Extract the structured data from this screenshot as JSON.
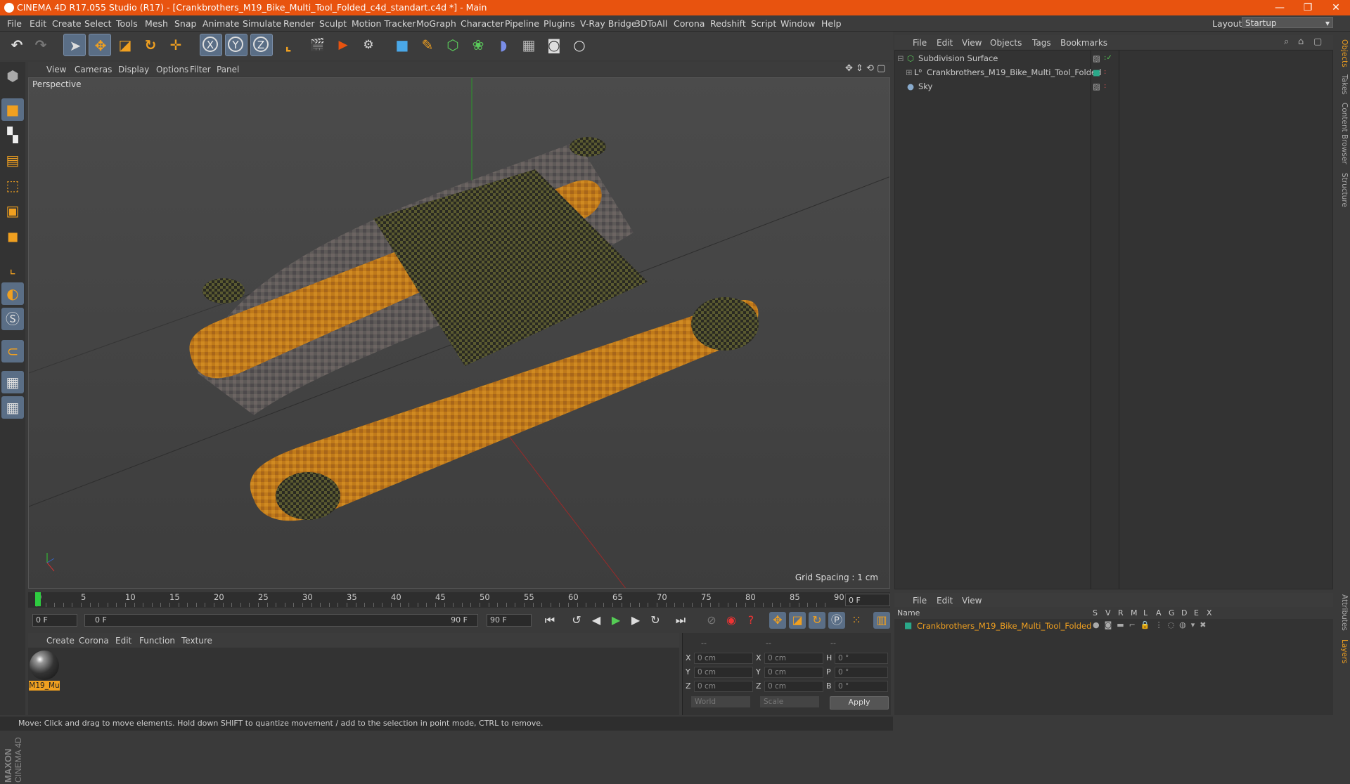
{
  "window": {
    "title": "CINEMA 4D R17.055 Studio (R17) - [Crankbrothers_M19_Bike_Multi_Tool_Folded_c4d_standart.c4d *] - Main",
    "minimize": "—",
    "restore": "❐",
    "close": "✕"
  },
  "menu": [
    "File",
    "Edit",
    "Create",
    "Select",
    "Tools",
    "Mesh",
    "Snap",
    "Animate",
    "Simulate",
    "Render",
    "Sculpt",
    "Motion Tracker",
    "MoGraph",
    "Character",
    "Pipeline",
    "Plugins",
    "V-Ray Bridge",
    "3DToAll",
    "Corona",
    "Redshift",
    "Script",
    "Window",
    "Help"
  ],
  "layout": {
    "label": "Layout:",
    "value": "Startup"
  },
  "viewport": {
    "menu": [
      "View",
      "Cameras",
      "Display",
      "Options",
      "Filter",
      "Panel"
    ],
    "label": "Perspective",
    "grid_spacing": "Grid Spacing : 1 cm"
  },
  "timeline": {
    "ticks": [
      "0",
      "5",
      "10",
      "15",
      "20",
      "25",
      "30",
      "35",
      "40",
      "45",
      "50",
      "55",
      "60",
      "65",
      "70",
      "75",
      "80",
      "85",
      "90"
    ],
    "current_frame": "0 F",
    "start": "0 F",
    "range_start": "0 F",
    "range_end": "90 F",
    "end": "90 F"
  },
  "materials": {
    "menu": [
      "Create",
      "Corona",
      "Edit",
      "Function",
      "Texture"
    ],
    "items": [
      {
        "name": "M19_Mu"
      }
    ]
  },
  "coordinates": {
    "headers": [
      "--",
      "--",
      "--"
    ],
    "rows": [
      {
        "l1": "X",
        "v1": "0 cm",
        "l2": "X",
        "v2": "0 cm",
        "l3": "H",
        "v3": "0 °"
      },
      {
        "l1": "Y",
        "v1": "0 cm",
        "l2": "Y",
        "v2": "0 cm",
        "l3": "P",
        "v3": "0 °"
      },
      {
        "l1": "Z",
        "v1": "0 cm",
        "l2": "Z",
        "v2": "0 cm",
        "l3": "B",
        "v3": "0 °"
      }
    ],
    "mode": "World",
    "scale": "Scale",
    "apply": "Apply"
  },
  "status": "Move: Click and drag to move elements. Hold down SHIFT to quantize movement / add to the selection in point mode, CTRL to remove.",
  "objects": {
    "menu": [
      "File",
      "Edit",
      "View",
      "Objects",
      "Tags",
      "Bookmarks"
    ],
    "rows": [
      {
        "name": "Subdivision Surface",
        "icon": "subdivision-icon"
      },
      {
        "name": "Crankbrothers_M19_Bike_Multi_Tool_Folded",
        "icon": "null-object-icon"
      },
      {
        "name": "Sky",
        "icon": "sky-icon"
      }
    ]
  },
  "layers": {
    "menu": [
      "File",
      "Edit",
      "View"
    ],
    "columns": [
      "Name",
      "S",
      "V",
      "R",
      "M",
      "L",
      "A",
      "G",
      "D",
      "E",
      "X"
    ],
    "rows": [
      {
        "name": "Crankbrothers_M19_Bike_Multi_Tool_Folded"
      }
    ]
  },
  "right_tabs": [
    "Objects",
    "Takes",
    "Content Browser",
    "Structure",
    "Attributes",
    "Layers"
  ],
  "brand": {
    "line1": "MAXON",
    "line2": "CINEMA 4D"
  },
  "colors": {
    "titlebar": "#e8530f",
    "selection": "#5a6e86",
    "material_label": "#f0a020",
    "layer_name": "#f0a020"
  }
}
